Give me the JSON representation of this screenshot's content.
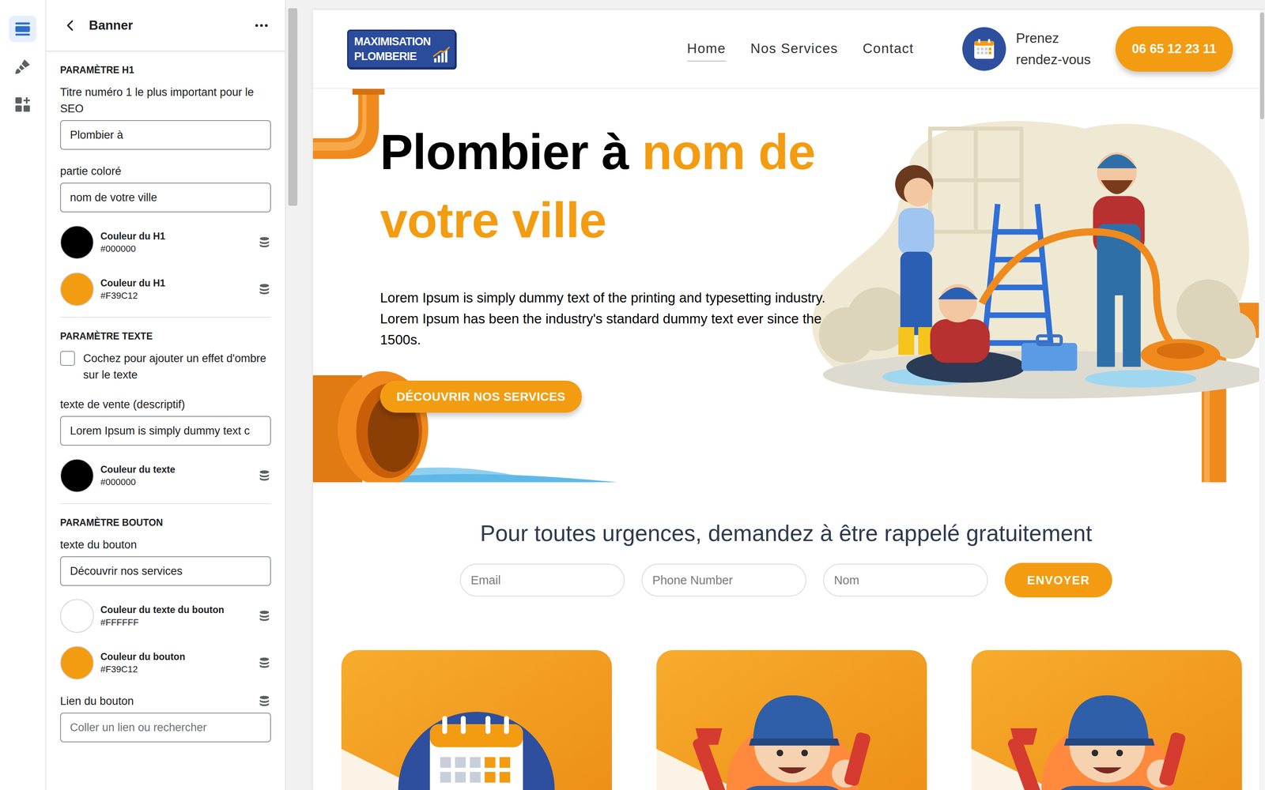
{
  "rail": [
    {
      "selected": true
    },
    {
      "selected": false
    },
    {
      "selected": false
    }
  ],
  "panel": {
    "title": "Banner",
    "sections": [
      {
        "title": "PARAMÈTRE H1",
        "items": [
          {
            "kind": "field",
            "label": "Titre numéro 1 le plus important pour le SEO",
            "value": "Plombier à"
          },
          {
            "kind": "field",
            "label": "partie coloré",
            "value": "nom de votre ville"
          },
          {
            "kind": "color",
            "label": "Couleur du H1",
            "value": "#000000"
          },
          {
            "kind": "color",
            "label": "Couleur du H1",
            "value": "#F39C12"
          }
        ]
      },
      {
        "title": "PARAMÈTRE TEXTE",
        "items": [
          {
            "kind": "checkbox",
            "label": "Cochez pour ajouter un effet d'ombre sur le texte",
            "checked": false
          },
          {
            "kind": "field",
            "label": "texte de vente (descriptif)",
            "value": "Lorem Ipsum is simply dummy text c"
          },
          {
            "kind": "color",
            "label": "Couleur du texte",
            "value": "#000000"
          }
        ]
      },
      {
        "title": "PARAMÈTRE BOUTON",
        "items": [
          {
            "kind": "field",
            "label": "texte du bouton",
            "value": "Découvrir nos services"
          },
          {
            "kind": "color",
            "label": "Couleur du texte du bouton",
            "value": "#FFFFFF"
          },
          {
            "kind": "color",
            "label": "Couleur du bouton",
            "value": "#F39C12"
          },
          {
            "kind": "link",
            "label": "Lien du bouton",
            "placeholder": "Coller un lien ou rechercher"
          }
        ]
      }
    ]
  },
  "preview": {
    "logo": [
      "MAXIMISATION",
      "PLOMBERIE"
    ],
    "nav": [
      {
        "label": "Home",
        "selected": true
      },
      {
        "label": "Nos Services",
        "selected": false
      },
      {
        "label": "Contact",
        "selected": false
      }
    ],
    "appointment": [
      "Prenez",
      "rendez-vous"
    ],
    "phone": "06 65 12 23 11",
    "hero": {
      "title": "Plombier à",
      "title_colored": "nom de votre ville",
      "text": "Lorem Ipsum is simply dummy text of the printing and typesetting industry. Lorem Ipsum has been the industry's standard dummy text ever since the 1500s.",
      "button": "DÉCOUVRIR NOS SERVICES"
    },
    "callback": {
      "title": "Pour toutes urgences, demandez à être rappelé gratuitement",
      "fields": [
        "Email",
        "Phone Number",
        "Nom"
      ],
      "button": "ENVOYER"
    },
    "cards": [
      {
        "kind": "calendar"
      },
      {
        "kind": "plumber"
      },
      {
        "kind": "plumber"
      }
    ]
  }
}
